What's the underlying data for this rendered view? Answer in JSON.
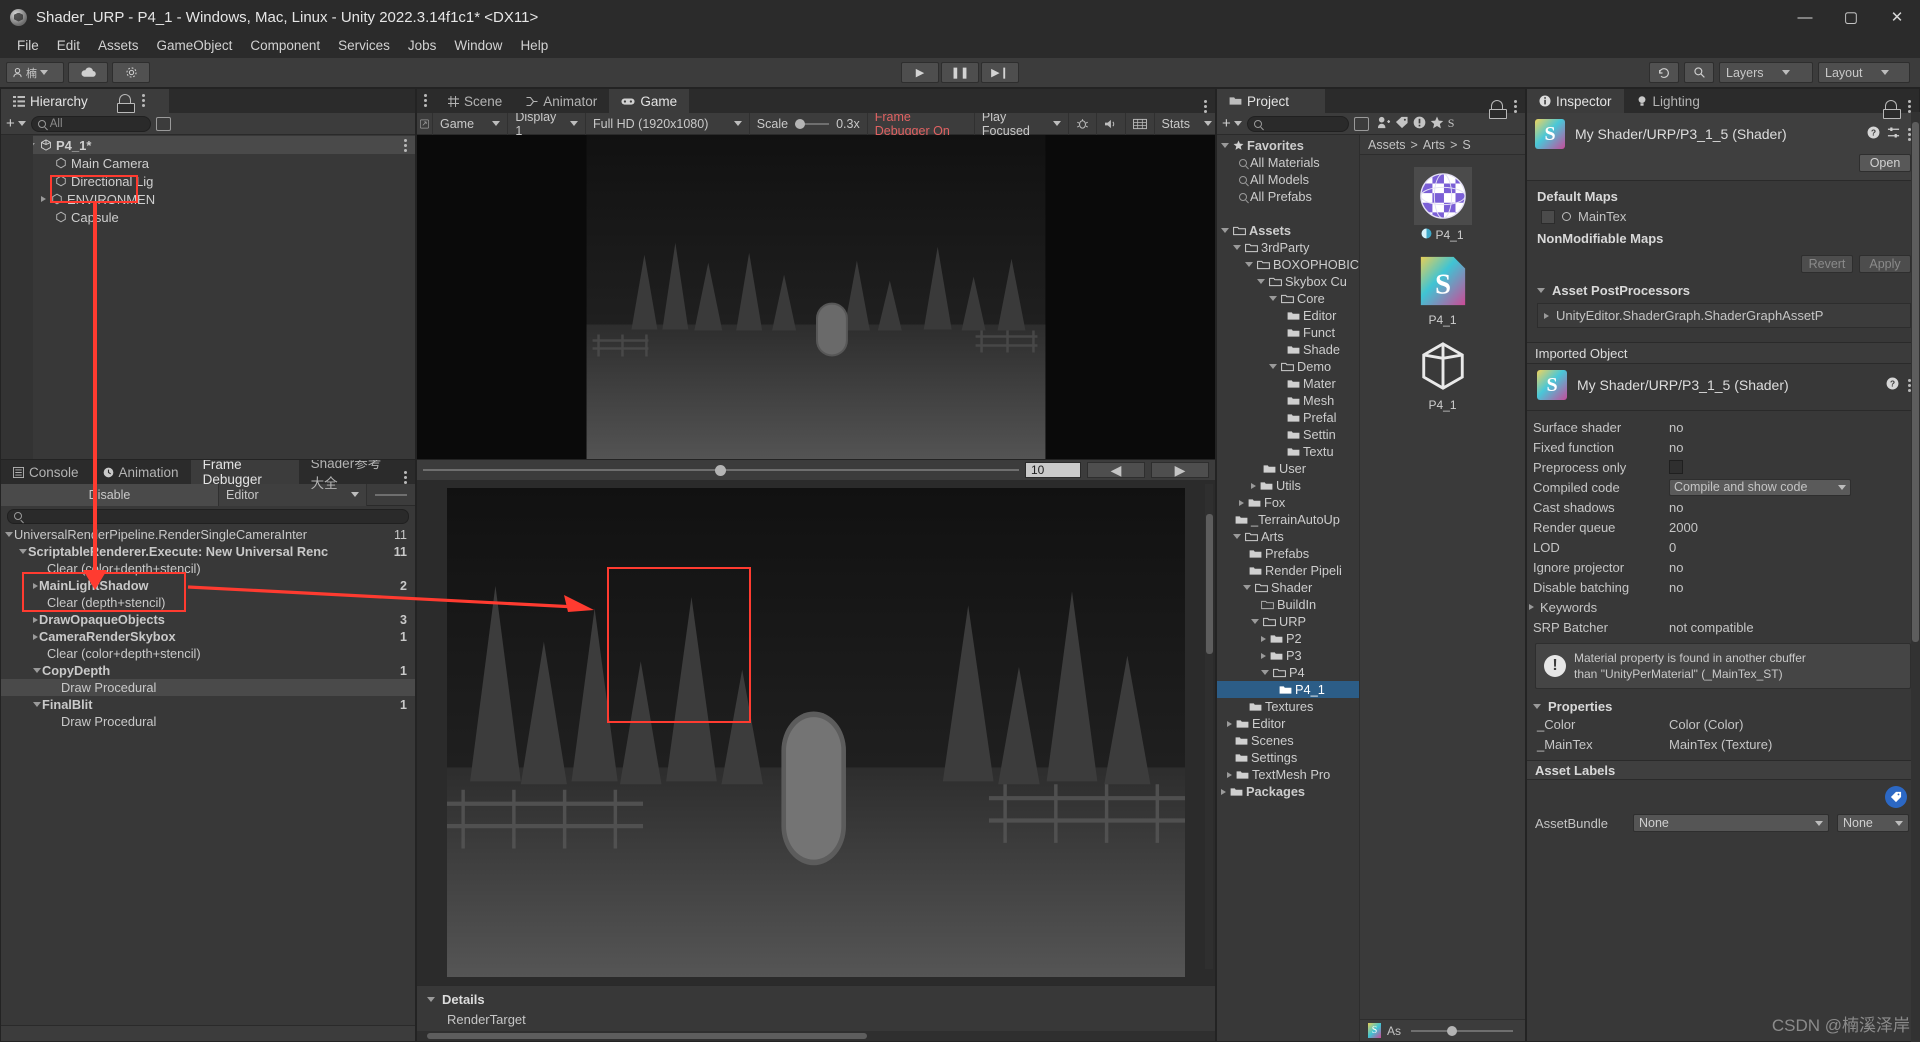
{
  "window": {
    "title": "Shader_URP - P4_1 - Windows, Mac, Linux - Unity 2022.3.14f1c1* <DX11>",
    "minimize": "—",
    "maximize": "▢",
    "close": "✕"
  },
  "menu": [
    "File",
    "Edit",
    "Assets",
    "GameObject",
    "Component",
    "Services",
    "Jobs",
    "Window",
    "Help"
  ],
  "toolbar": {
    "account_label": "楠",
    "cloud_icon": "cloud-icon",
    "settings_icon": "gear-icon",
    "play": "▶",
    "pause": "❚❚",
    "step": "▶❙",
    "history_icon": "history-icon",
    "search_icon": "search-icon",
    "layers": "Layers",
    "layout": "Layout"
  },
  "hierarchy": {
    "tab": "Hierarchy",
    "create_label": "+",
    "search_placeholder": "All",
    "items": [
      {
        "label": "P4_1*",
        "indent": 1,
        "icon": "unity-scene-icon",
        "expanded": true,
        "kebab": true
      },
      {
        "label": "Main Camera",
        "indent": 3,
        "icon": "gameobject-icon"
      },
      {
        "label": "Directional Lig",
        "indent": 3,
        "icon": "gameobject-icon"
      },
      {
        "label": "ENVIRONMEN",
        "indent": 2,
        "icon": "gameobject-icon",
        "collapsed": true
      },
      {
        "label": "Capsule",
        "indent": 3,
        "icon": "gameobject-icon",
        "highlighted": true
      }
    ]
  },
  "center": {
    "tabs": [
      {
        "label": "Scene",
        "icon": "grid-icon",
        "active": false
      },
      {
        "label": "Animator",
        "icon": "animator-icon",
        "active": false
      },
      {
        "label": "Game",
        "icon": "gamepad-icon",
        "active": true
      }
    ],
    "gamebar": {
      "view": "Game",
      "display": "Display 1",
      "resolution": "Full HD (1920x1080)",
      "scale_label": "Scale",
      "scale_value": "0.3x",
      "frame_debugger": "Frame Debugger On",
      "play_focused": "Play Focused",
      "mute_icon": "mute-audio-icon",
      "bug_icon": "bug-icon",
      "gizmos_icon": "gizmos-icon",
      "stats": "Stats"
    }
  },
  "bottom": {
    "tabs": [
      {
        "label": "Console",
        "icon": "console-icon",
        "active": false
      },
      {
        "label": "Animation",
        "icon": "clock-icon",
        "active": false
      },
      {
        "label": "Frame Debugger",
        "icon": "",
        "active": true
      },
      {
        "label": "Shader参考大全",
        "icon": "",
        "active": false
      }
    ],
    "disable_button": "Disable",
    "target_select": "Editor",
    "search_placeholder": "",
    "tree": [
      {
        "label": "UniversalRenderPipeline.RenderSingleCameraInter",
        "count": "11",
        "indent": 0,
        "arrow": "open",
        "bold": false
      },
      {
        "label": "ScriptableRenderer.Execute: New Universal Renc",
        "count": "11",
        "indent": 1,
        "arrow": "open",
        "bold": true
      },
      {
        "label": "Clear (color+depth+stencil)",
        "count": "",
        "indent": 2,
        "arrow": "none",
        "bold": false
      },
      {
        "label": "MainLightShadow",
        "count": "2",
        "indent": 2,
        "arrow": "closed",
        "bold": true
      },
      {
        "label": "Clear (depth+stencil)",
        "count": "",
        "indent": 2,
        "arrow": "none",
        "bold": false
      },
      {
        "label": "DrawOpaqueObjects",
        "count": "3",
        "indent": 2,
        "arrow": "closed",
        "bold": true
      },
      {
        "label": "CameraRenderSkybox",
        "count": "1",
        "indent": 2,
        "arrow": "closed",
        "bold": true
      },
      {
        "label": "Clear (color+depth+stencil)",
        "count": "",
        "indent": 2,
        "arrow": "none",
        "bold": false
      },
      {
        "label": "CopyDepth",
        "count": "1",
        "indent": 2,
        "arrow": "open",
        "bold": true
      },
      {
        "label": "Draw Procedural",
        "count": "",
        "indent": 3,
        "arrow": "none",
        "bold": false,
        "selected": true
      },
      {
        "label": "FinalBlit",
        "count": "1",
        "indent": 2,
        "arrow": "open",
        "bold": true
      },
      {
        "label": "Draw Procedural",
        "count": "",
        "indent": 3,
        "arrow": "none",
        "bold": false
      }
    ],
    "preview": {
      "frame_number": "10",
      "prev_icon": "◀",
      "next_icon": "▶",
      "details_label": "Details",
      "render_target_label": "RenderTarget"
    }
  },
  "project": {
    "tab": "Project",
    "create_label": "+",
    "search_placeholder": "",
    "toolbar_icons": [
      "save-search-icon",
      "label-icon",
      "warning-icon",
      "star-icon",
      "shader-filter-icon"
    ],
    "breadcrumb": [
      "Assets",
      "Arts",
      "S"
    ],
    "tree": [
      {
        "label": "Favorites",
        "indent": 0,
        "arrow": "open",
        "icon": "star",
        "bold": true
      },
      {
        "label": "All Materials",
        "indent": 1,
        "arrow": "none",
        "icon": "search"
      },
      {
        "label": "All Models",
        "indent": 1,
        "arrow": "none",
        "icon": "search"
      },
      {
        "label": "All Prefabs",
        "indent": 1,
        "arrow": "none",
        "icon": "search"
      },
      {
        "label": "",
        "indent": 0,
        "arrow": "none",
        "icon": "none"
      },
      {
        "label": "Assets",
        "indent": 0,
        "arrow": "open",
        "icon": "folder-open",
        "bold": true
      },
      {
        "label": "3rdParty",
        "indent": 1,
        "arrow": "open",
        "icon": "folder-open"
      },
      {
        "label": "BOXOPHOBIC",
        "indent": 2,
        "arrow": "open",
        "icon": "folder-open"
      },
      {
        "label": "Skybox Cu",
        "indent": 3,
        "arrow": "open",
        "icon": "folder-open"
      },
      {
        "label": "Core",
        "indent": 4,
        "arrow": "open",
        "icon": "folder-open"
      },
      {
        "label": "Editor",
        "indent": 5,
        "arrow": "none",
        "icon": "folder"
      },
      {
        "label": "Funct",
        "indent": 5,
        "arrow": "none",
        "icon": "folder"
      },
      {
        "label": "Shade",
        "indent": 5,
        "arrow": "none",
        "icon": "folder"
      },
      {
        "label": "Demo",
        "indent": 4,
        "arrow": "open",
        "icon": "folder-open"
      },
      {
        "label": "Mater",
        "indent": 5,
        "arrow": "none",
        "icon": "folder"
      },
      {
        "label": "Mesh",
        "indent": 5,
        "arrow": "none",
        "icon": "folder"
      },
      {
        "label": "Prefal",
        "indent": 5,
        "arrow": "none",
        "icon": "folder"
      },
      {
        "label": "Settin",
        "indent": 5,
        "arrow": "none",
        "icon": "folder"
      },
      {
        "label": "Textu",
        "indent": 5,
        "arrow": "none",
        "icon": "folder"
      },
      {
        "label": "User",
        "indent": 3,
        "arrow": "none",
        "icon": "folder"
      },
      {
        "label": "Utils",
        "indent": 3,
        "arrow": "closed",
        "icon": "folder"
      },
      {
        "label": "Fox",
        "indent": 2,
        "arrow": "closed",
        "icon": "folder"
      },
      {
        "label": "_TerrainAutoUp",
        "indent": 2,
        "arrow": "none",
        "icon": "folder"
      },
      {
        "label": "Arts",
        "indent": 1,
        "arrow": "open",
        "icon": "folder-open"
      },
      {
        "label": "Prefabs",
        "indent": 2,
        "arrow": "none",
        "icon": "folder"
      },
      {
        "label": "Render Pipeli",
        "indent": 2,
        "arrow": "none",
        "icon": "folder"
      },
      {
        "label": "Shader",
        "indent": 2,
        "arrow": "open",
        "icon": "folder-open"
      },
      {
        "label": "BuildIn",
        "indent": 3,
        "arrow": "none",
        "icon": "folder-empty"
      },
      {
        "label": "URP",
        "indent": 3,
        "arrow": "open",
        "icon": "folder-open"
      },
      {
        "label": "P2",
        "indent": 4,
        "arrow": "closed",
        "icon": "folder"
      },
      {
        "label": "P3",
        "indent": 4,
        "arrow": "closed",
        "icon": "folder"
      },
      {
        "label": "P4",
        "indent": 4,
        "arrow": "open",
        "icon": "folder-open"
      },
      {
        "label": "P4_1",
        "indent": 5,
        "arrow": "none",
        "icon": "folder",
        "selected": true
      },
      {
        "label": "Textures",
        "indent": 2,
        "arrow": "none",
        "icon": "folder"
      },
      {
        "label": "Editor",
        "indent": 1,
        "arrow": "closed",
        "icon": "folder"
      },
      {
        "label": "Scenes",
        "indent": 1,
        "arrow": "none",
        "icon": "folder"
      },
      {
        "label": "Settings",
        "indent": 1,
        "arrow": "none",
        "icon": "folder"
      },
      {
        "label": "TextMesh Pro",
        "indent": 1,
        "arrow": "closed",
        "icon": "folder"
      },
      {
        "label": "Packages",
        "indent": 0,
        "arrow": "closed",
        "icon": "folder",
        "bold": true
      }
    ],
    "assets": [
      {
        "name": "P4_1",
        "kind": "material-sphere",
        "badge": "material-icon"
      },
      {
        "name": "P4_1",
        "kind": "shader-graph"
      },
      {
        "name": "P4_1",
        "kind": "unity-mesh"
      }
    ],
    "footer": {
      "badge": "S",
      "label": "As",
      "zoom_percent": 35
    }
  },
  "inspector": {
    "tabs": [
      {
        "label": "Inspector",
        "icon": "info-icon",
        "active": true
      },
      {
        "label": "Lighting",
        "icon": "light-icon",
        "active": false
      }
    ],
    "asset_title": "My Shader/URP/P3_1_5 (Shader)",
    "open_button": "Open",
    "default_maps_label": "Default Maps",
    "maintex_label": "MainTex",
    "nonmodifiable_label": "NonModifiable Maps",
    "revert_button": "Revert",
    "apply_button": "Apply",
    "postprocessors_label": "Asset PostProcessors",
    "postprocessor_item": "UnityEditor.ShaderGraph.ShaderGraphAssetP",
    "imported_object_label": "Imported Object",
    "imported_title": "My Shader/URP/P3_1_5 (Shader)",
    "props": [
      {
        "key": "Surface shader",
        "value": "no"
      },
      {
        "key": "Fixed function",
        "value": "no"
      },
      {
        "key": "Preprocess only",
        "value": "",
        "type": "checkbox"
      },
      {
        "key": "Compiled code",
        "value": "Compile and show code",
        "type": "dropdown"
      },
      {
        "key": "Cast shadows",
        "value": "no"
      },
      {
        "key": "Render queue",
        "value": "2000"
      },
      {
        "key": "LOD",
        "value": "0"
      },
      {
        "key": "Ignore projector",
        "value": "no"
      },
      {
        "key": "Disable batching",
        "value": "no"
      }
    ],
    "keywords_label": "Keywords",
    "srp_key": "SRP Batcher",
    "srp_value": "not compatible",
    "warning_line1": "Material property is found in another cbuffer",
    "warning_line2": "than \"UnityPerMaterial\" (_MainTex_ST)",
    "properties_label": "Properties",
    "properties": [
      {
        "key": "_Color",
        "value": "Color (Color)"
      },
      {
        "key": "_MainTex",
        "value": "MainTex (Texture)"
      }
    ],
    "asset_labels_title": "Asset Labels",
    "assetbundle_label": "AssetBundle",
    "assetbundle_value": "None",
    "variant_value": "None"
  },
  "watermark": "CSDN @楠溪泽岸",
  "colors": {
    "accent_red": "#ff3b30",
    "selection_blue": "#2c5d87",
    "panel_bg": "#383838",
    "chrome_bg": "#2b2b2b"
  }
}
